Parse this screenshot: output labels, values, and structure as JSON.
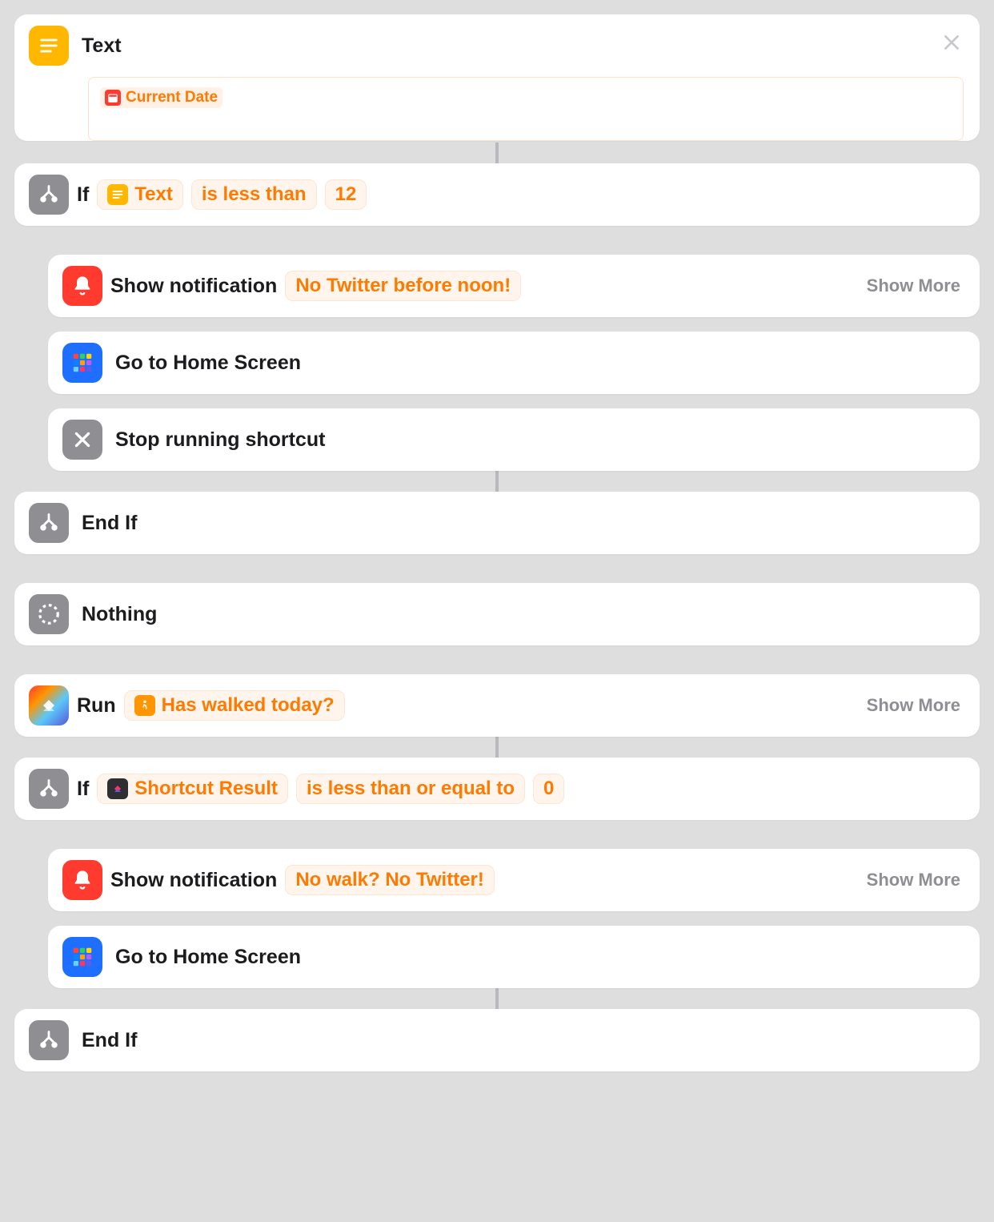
{
  "text_action": {
    "title": "Text",
    "token_label": "Current Date",
    "token_icon": "calendar-icon"
  },
  "if1": {
    "label": "If",
    "var_icon": "text-icon",
    "var_label": "Text",
    "op": "is less than",
    "value": "12"
  },
  "notify1": {
    "title": "Show notification",
    "message": "No Twitter before noon!",
    "show_more": "Show More"
  },
  "home1": {
    "title": "Go to Home Screen"
  },
  "stop": {
    "title": "Stop running shortcut"
  },
  "endif1": {
    "title": "End If"
  },
  "nothing": {
    "title": "Nothing"
  },
  "run": {
    "title": "Run",
    "shortcut_icon": "walk-icon",
    "shortcut_label": "Has walked today?",
    "show_more": "Show More"
  },
  "if2": {
    "label": "If",
    "var_icon": "shortcuts-icon",
    "var_label": "Shortcut Result",
    "op": "is less than or equal to",
    "value": "0"
  },
  "notify2": {
    "title": "Show notification",
    "message": "No walk? No Twitter!",
    "show_more": "Show More"
  },
  "home2": {
    "title": "Go to Home Screen"
  },
  "endif2": {
    "title": "End If"
  }
}
